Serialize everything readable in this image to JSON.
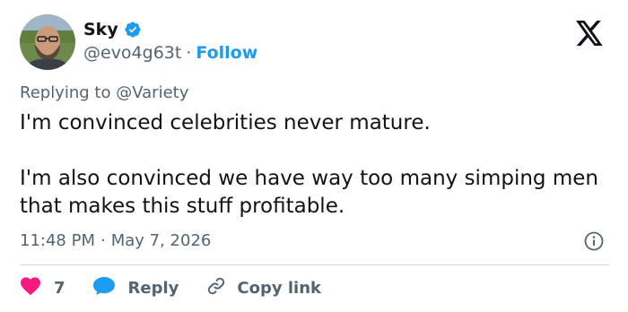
{
  "author": {
    "display_name": "Sky",
    "handle": "@evo4g63t",
    "follow_label": "Follow",
    "separator": "·"
  },
  "reply_context": {
    "prefix": "Replying to",
    "mention": "@Variety"
  },
  "tweet": {
    "paragraphs": [
      "I'm convinced celebrities never mature.",
      "I'm also convinced we have way too many simping men that makes this stuff profitable."
    ],
    "time": "11:48 PM",
    "date": "May 7, 2026",
    "separator": "·"
  },
  "actions": {
    "like_count": "7",
    "reply_label": "Reply",
    "copy_label": "Copy link"
  },
  "icons": {
    "verified": "verified-badge-icon",
    "logo": "x-logo-icon",
    "info": "info-icon",
    "like": "heart-icon",
    "reply": "speech-bubble-icon",
    "copy": "link-icon"
  },
  "colors": {
    "text": "#0f1419",
    "secondary": "#536471",
    "accent": "#1d9bf0",
    "like": "#f91880",
    "divider": "#cfd9de"
  }
}
